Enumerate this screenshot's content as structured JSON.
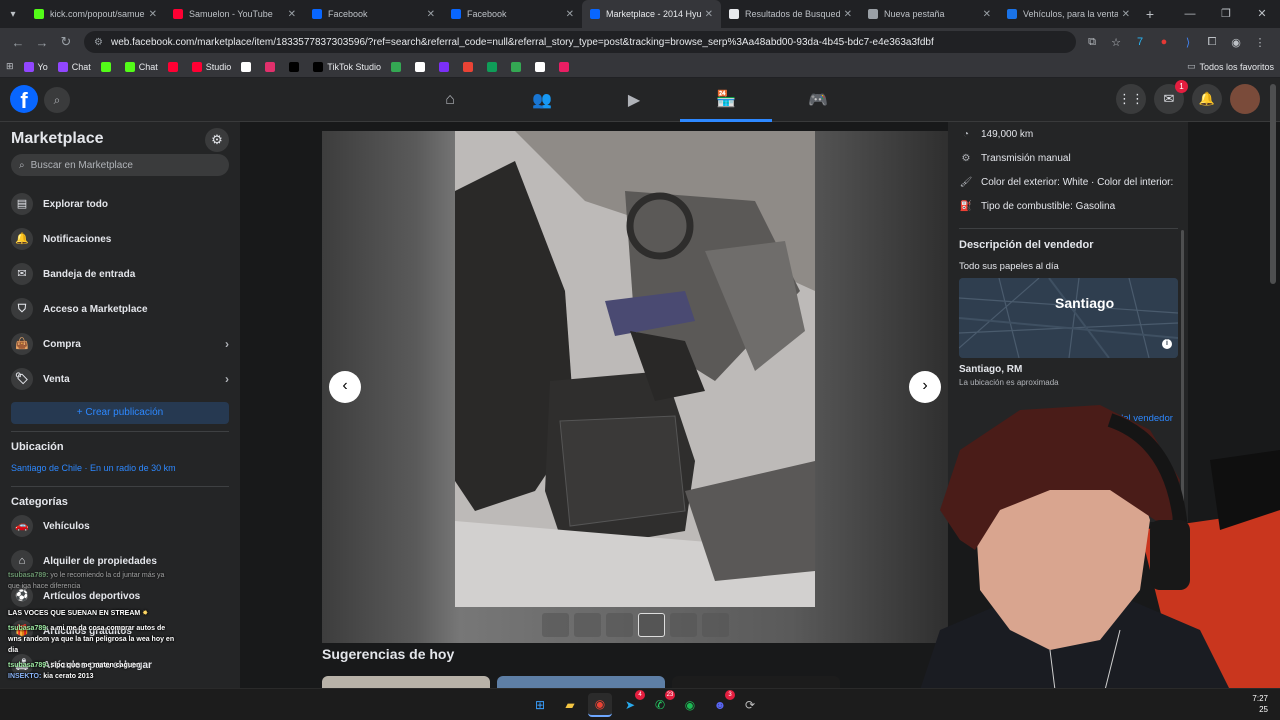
{
  "tabs": [
    {
      "title": "kick.com/popout/samuel",
      "color": "#53fc18"
    },
    {
      "title": "Samuelon - YouTube",
      "color": "#ff0033"
    },
    {
      "title": "Facebook",
      "color": "#0866ff"
    },
    {
      "title": "Facebook",
      "color": "#0866ff"
    },
    {
      "title": "Marketplace - 2014 Hyun",
      "color": "#0866ff",
      "active": true
    },
    {
      "title": "Resultados de Busqueda",
      "color": "#e8eaed"
    },
    {
      "title": "Nueva pestaña",
      "color": "#9aa0a6"
    },
    {
      "title": "Vehículos, para la venta, C",
      "color": "#1a73e8"
    }
  ],
  "address": {
    "url": "web.facebook.com/marketplace/item/1833577837303596/?ref=search&referral_code=null&referral_story_type=post&tracking=browse_serp%3Aa48abd00-93da-4b45-bdc7-e4e363a3fdbf"
  },
  "bookmarks": [
    {
      "label": "Yo",
      "color": "#9146ff"
    },
    {
      "label": "Chat",
      "color": "#9146ff"
    },
    {
      "label": "",
      "color": "#53fc18"
    },
    {
      "label": "Chat",
      "color": "#53fc18"
    },
    {
      "label": "",
      "color": "#ff0033"
    },
    {
      "label": "Studio",
      "color": "#ff0033"
    },
    {
      "label": "",
      "color": "#ffffff"
    },
    {
      "label": "",
      "color": "#e1306c"
    },
    {
      "label": "",
      "color": "#000000"
    },
    {
      "label": "TikTok Studio",
      "color": "#000000"
    },
    {
      "label": "",
      "color": "#34a853"
    },
    {
      "label": "",
      "color": "#ffffff"
    },
    {
      "label": "",
      "color": "#7b2ff7"
    },
    {
      "label": "",
      "color": "#ea4335"
    },
    {
      "label": "",
      "color": "#0f9d58"
    },
    {
      "label": "",
      "color": "#34a853"
    },
    {
      "label": "",
      "color": "#ffffff"
    },
    {
      "label": "",
      "color": "#e91e63"
    }
  ],
  "bookmarks_all": "Todos los favoritos",
  "nav": {
    "messenger_badge": "1"
  },
  "sidebar": {
    "title": "Marketplace",
    "search_placeholder": "Buscar en Marketplace",
    "items": [
      {
        "label": "Explorar todo",
        "icon": "storefront-icon"
      },
      {
        "label": "Notificaciones",
        "icon": "bell-icon"
      },
      {
        "label": "Bandeja de entrada",
        "icon": "inbox-icon"
      },
      {
        "label": "Acceso a Marketplace",
        "icon": "shield-icon"
      },
      {
        "label": "Compra",
        "icon": "bag-icon"
      },
      {
        "label": "Venta",
        "icon": "tag-icon"
      }
    ],
    "create_label": "+ Crear publicación",
    "location_heading": "Ubicación",
    "location_value": "Santiago de Chile · En un radio de 30 km",
    "categories_heading": "Categorías",
    "categories": [
      {
        "label": "Vehículos"
      },
      {
        "label": "Alquiler de propiedades"
      },
      {
        "label": "Artículos deportivos"
      },
      {
        "label": "Artículos gratuitos"
      },
      {
        "label": "Artículos para el hogar"
      }
    ]
  },
  "chat": [
    {
      "user": "tsubasa789:",
      "text": "yo le recomiendo la cd juntar más ya que iga hace diferencia"
    },
    {
      "user": "",
      "text": "LAS VOCES QUE SUENAN EN STREAM"
    },
    {
      "user": "tsubasa789:",
      "text": "a mi me da cosa comprar autos de wns random ya que la tan peligrosa la wea hoy en dia"
    },
    {
      "user": "tsubasa789:",
      "text": "sipo que me maten caguen"
    },
    {
      "user": "INSEKTO:",
      "text": "kia cerato 2013"
    }
  ],
  "details": {
    "specs": [
      {
        "icon": "gauge-icon",
        "text": "149,000 km"
      },
      {
        "icon": "gearbox-icon",
        "text": "Transmisión manual"
      },
      {
        "icon": "paint-icon",
        "text": "Color del exterior: White · Color del interior:"
      },
      {
        "icon": "fuel-icon",
        "text": "Tipo de combustible: Gasolina"
      }
    ],
    "seller_heading": "Descripción del vendedor",
    "seller_text": "Todo sus papeles al día",
    "map_city": "Santiago",
    "city": "Santiago, RM",
    "approx": "La ubicación es aproximada",
    "seller_details": "Detalles del vendedor"
  },
  "suggestions_title": "Sugerencias de hoy",
  "taskbar": {
    "telegram_badge": "4",
    "whatsapp_badge": "23",
    "discord_badge": "3",
    "time": "7:27",
    "date": "25"
  }
}
